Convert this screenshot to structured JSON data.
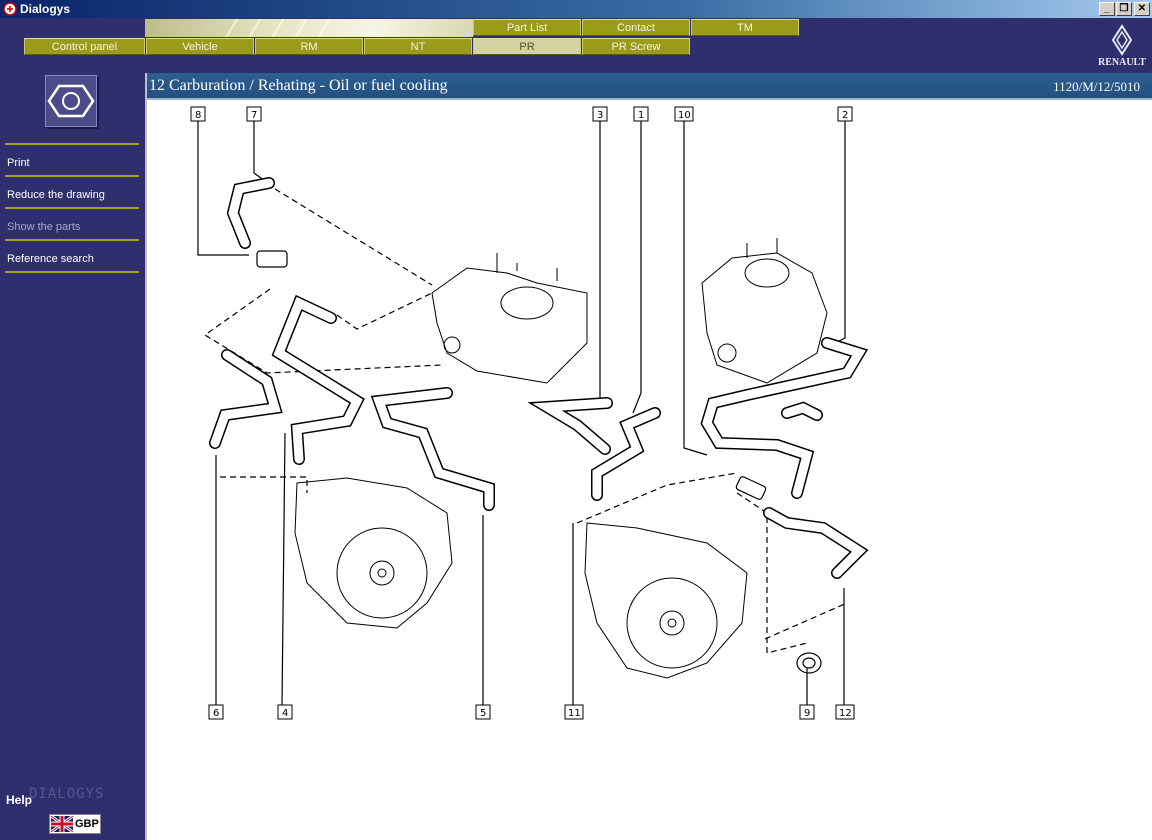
{
  "window": {
    "title": "Dialogys",
    "minimize": "_",
    "restore": "❐",
    "close": "✕"
  },
  "tabs_top": [
    {
      "label": "Part List"
    },
    {
      "label": "Contact"
    },
    {
      "label": "TM"
    }
  ],
  "tabs_bottom": [
    {
      "label": "Control panel"
    },
    {
      "label": "Vehicle"
    },
    {
      "label": "RM"
    },
    {
      "label": "NT"
    },
    {
      "label": "PR",
      "active": true
    },
    {
      "label": "PR Screw"
    }
  ],
  "brand": {
    "name": "RENAULT"
  },
  "sidebar": {
    "items": [
      {
        "label": "Print",
        "enabled": true
      },
      {
        "label": "Reduce the drawing",
        "enabled": true
      },
      {
        "label": "Show the parts",
        "enabled": false
      },
      {
        "label": "Reference search",
        "enabled": true
      }
    ],
    "help_label": "Help",
    "app_wordmark": "DIALOGYS",
    "language": {
      "code": "GBP",
      "flag_icon": "uk-flag-icon"
    }
  },
  "content": {
    "heading": "12 Carburation / Rehating - Oil or fuel cooling",
    "reference": "1120/M/12/5010"
  },
  "callouts": [
    "8",
    "7",
    "3",
    "1",
    "10",
    "2",
    "6",
    "4",
    "5",
    "11",
    "9",
    "12"
  ],
  "colors": {
    "frame": "#2f2f6e",
    "tab": "#9b9b1a",
    "tab_active": "#d3d3a2",
    "heading_bar": "#2d5f91",
    "divider": "#a5a51d"
  }
}
